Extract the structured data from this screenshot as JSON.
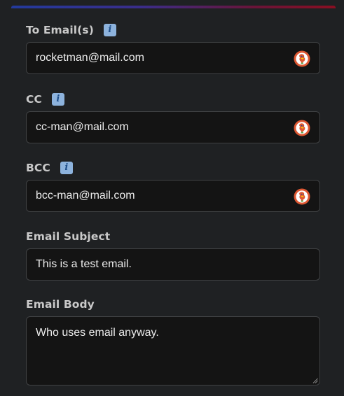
{
  "form": {
    "to": {
      "label": "To Email(s)",
      "info_icon": "info-icon",
      "value": "rocketman@mail.com",
      "autofill_icon": "duckduckgo-icon"
    },
    "cc": {
      "label": "CC",
      "info_icon": "info-icon",
      "value": "cc-man@mail.com",
      "autofill_icon": "duckduckgo-icon"
    },
    "bcc": {
      "label": "BCC",
      "info_icon": "info-icon",
      "value": "bcc-man@mail.com",
      "autofill_icon": "duckduckgo-icon"
    },
    "subject": {
      "label": "Email Subject",
      "value": "This is a test email."
    },
    "body": {
      "label": "Email Body",
      "value": "Who uses email anyway."
    }
  },
  "colors": {
    "background": "#1f2123",
    "input_background": "#141414",
    "input_border": "#404244",
    "label": "#c9c9c9",
    "accent_gradient_start": "#233a9c",
    "accent_gradient_end": "#8a0f22"
  }
}
